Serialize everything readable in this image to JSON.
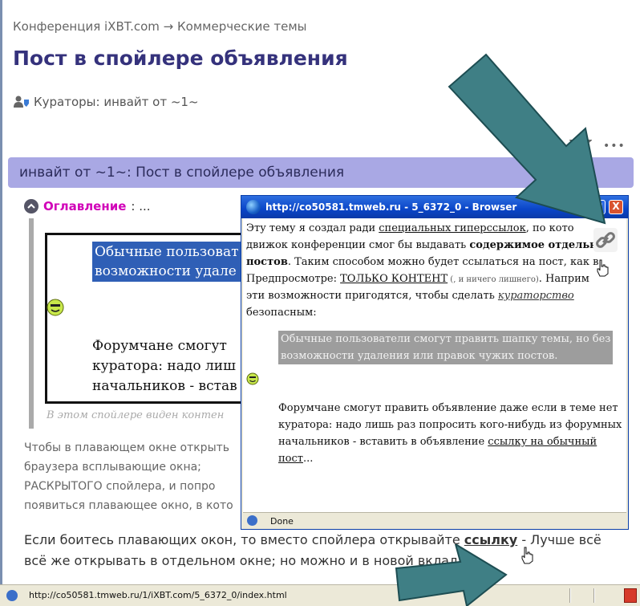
{
  "breadcrumb": "Конференция iXBT.com → Коммерческие темы",
  "page_title": "Пост в спойлере объявления",
  "curators": "Кураторы: инвайт от ~1~",
  "topic_bar": "инвайт от ~1~: Пост в спойлере объявления",
  "more_dots": "•••",
  "toc": {
    "label": "Оглавление",
    "rest": ": ..."
  },
  "spoiler": {
    "selected_lines": [
      "Обычные пользоват",
      "возможности удале"
    ],
    "forum_lines": [
      "Форумчане смогут",
      "куратора: надо лиш",
      "начальников - встав"
    ],
    "note": "В этом спойлере виден контен"
  },
  "para_lines": [
    "Чтобы в плавающем окне открыть",
    "браузера всплывающие окна;",
    "РАСКРЫТОГО спойлера, и попро",
    "появиться плавающее окно, в кото"
  ],
  "bottom": {
    "line1_a": "Если боитесь плавающих окон, то вместо спойлера открывайте ",
    "line1_link": "ссылку",
    "line1_b": " - Лучше всё",
    "line2": "всё же открывать в отдельном окне; но можно и в новой вкладке."
  },
  "statusbar": {
    "url": "http://co50581.tmweb.ru/1/iXBT.com/5_6372_0/index.html"
  },
  "popup": {
    "title": "http://co50581.tmweb.ru - 5_6372_0 - Browser",
    "buttons": {
      "min": "_",
      "max": "□",
      "close": "X"
    },
    "body": {
      "l1_a": "Эту тему я создал ради ",
      "l1_link": "специальных гиперссылок",
      "l1_b": ", по кото",
      "l2_a": "движок конференции смог бы выдавать ",
      "l2_b": "содержимое отдельн",
      "l3_a": "постов",
      "l3_b": ". Таким способом можно будет ссылаться на пост, как в",
      "l4_a": "Предпросмотре: ",
      "l4_link": "ТОЛЬКО КОНТЕНТ",
      "l4_small": " (, и ничего лишнего)",
      "l4_b": ". Наприм",
      "l5_a": "эти возможности пригодятся, чтобы сделать ",
      "l5_link": "кураторство",
      "l6": "безопасным:",
      "q_sel_1": "Обычные пользователи смогут править шапку темы, но без",
      "q_sel_2": "возможности удаления или правок чужих постов.",
      "q_text_1": "Форумчане смогут править объявление даже если в теме нет",
      "q_text_2": "куратора: надо лишь раз попросить кого-нибудь из форумных",
      "q_text_3_a": "начальников - вставить в объявление ",
      "q_text_3_link": "ссылку на обычный",
      "q_text_4_link": "пост",
      "q_text_4_b": "..."
    },
    "status": "Done"
  },
  "colors": {
    "title": "#35327c",
    "topic_bar": "#a9a8e4",
    "toc_label": "#d100b8",
    "arrow": "#3f7f85",
    "titlebar": "#0a45c8"
  }
}
